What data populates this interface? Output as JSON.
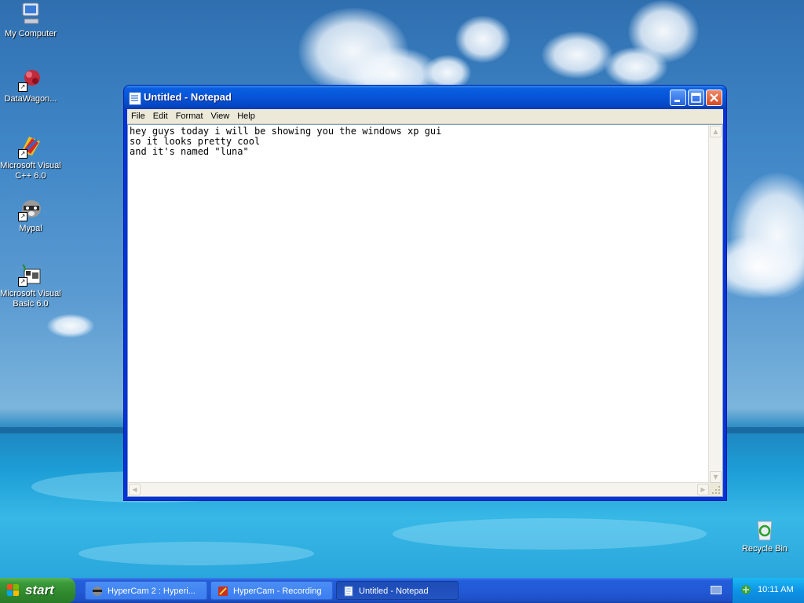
{
  "desktop": {
    "icons": [
      {
        "label": "My Computer",
        "icon": "my-computer-icon"
      },
      {
        "label": "DataWagon...",
        "icon": "datawagon-icon"
      },
      {
        "label": "Microsoft Visual C++ 6.0",
        "icon": "visual-cpp-icon"
      },
      {
        "label": "Mypal",
        "icon": "mypal-raccoon-icon"
      },
      {
        "label": "Microsoft Visual Basic 6.0",
        "icon": "visual-basic-icon"
      }
    ],
    "recycle_bin": {
      "label": "Recycle Bin",
      "icon": "recycle-bin-icon"
    }
  },
  "window": {
    "title": "Untitled - Notepad",
    "menu": [
      "File",
      "Edit",
      "Format",
      "View",
      "Help"
    ],
    "content": "hey guys today i will be showing you the windows xp gui\nso it looks pretty cool\nand it's named \"luna\""
  },
  "taskbar": {
    "start_label": "start",
    "tasks": [
      {
        "label": "HyperCam 2 : Hyperi...",
        "icon": "hypercam-icon",
        "active": false
      },
      {
        "label": "HyperCam - Recording",
        "icon": "hypercam-recording-icon",
        "active": false
      },
      {
        "label": "Untitled - Notepad",
        "icon": "notepad-icon",
        "active": true
      }
    ],
    "clock": "10:11 AM"
  },
  "colors": {
    "titlebar": "#0754d8",
    "taskbar": "#245edb",
    "start_button": "#3c9a3a",
    "tray": "#0e94e6"
  }
}
